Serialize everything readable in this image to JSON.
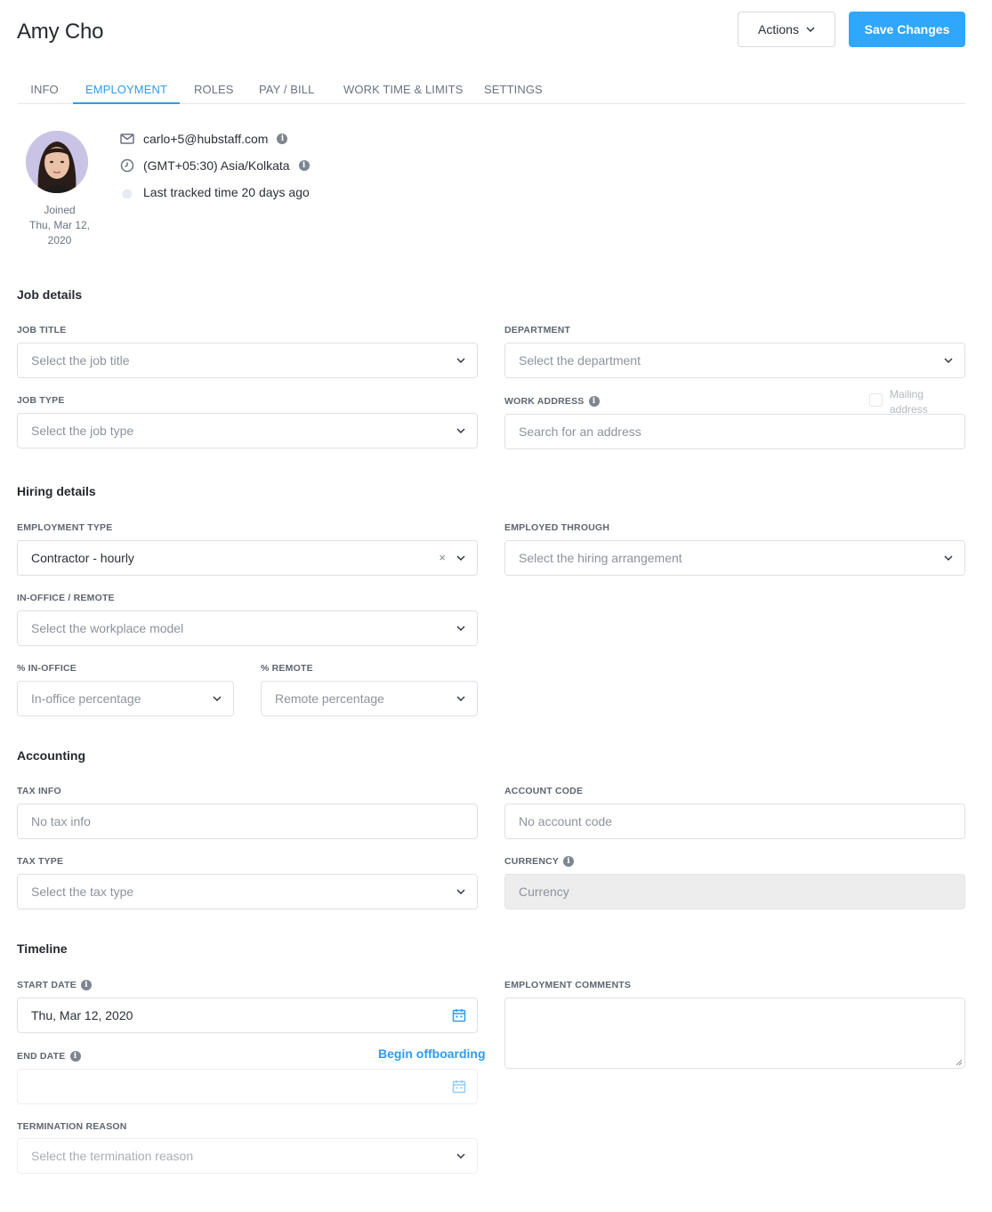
{
  "header": {
    "name": "Amy Cho",
    "actions_label": "Actions",
    "save_label": "Save Changes"
  },
  "tabs": [
    {
      "label": "INFO"
    },
    {
      "label": "EMPLOYMENT",
      "active": true
    },
    {
      "label": "ROLES"
    },
    {
      "label": "PAY / BILL"
    },
    {
      "label": "WORK TIME & LIMITS"
    },
    {
      "label": "SETTINGS"
    }
  ],
  "profile": {
    "joined_label": "Joined",
    "joined_date": "Thu, Mar 12, 2020",
    "email": "carlo+5@hubstaff.com",
    "timezone": "(GMT+05:30) Asia/Kolkata",
    "last_tracked": "Last tracked time 20 days ago"
  },
  "job_details": {
    "heading": "Job details",
    "job_title_label": "JOB TITLE",
    "job_title_placeholder": "Select the job title",
    "department_label": "DEPARTMENT",
    "department_placeholder": "Select the department",
    "job_type_label": "JOB TYPE",
    "job_type_placeholder": "Select the job type",
    "work_address_label": "WORK ADDRESS",
    "work_address_placeholder": "Search for an address",
    "mailing_address_label": "Mailing address"
  },
  "hiring_details": {
    "heading": "Hiring details",
    "employment_type_label": "EMPLOYMENT TYPE",
    "employment_type_value": "Contractor - hourly",
    "employed_through_label": "EMPLOYED THROUGH",
    "employed_through_placeholder": "Select the hiring arrangement",
    "workplace_label": "IN-OFFICE / REMOTE",
    "workplace_placeholder": "Select the workplace model",
    "in_office_label": "% IN-OFFICE",
    "in_office_placeholder": "In-office percentage",
    "remote_label": "% REMOTE",
    "remote_placeholder": "Remote percentage"
  },
  "accounting": {
    "heading": "Accounting",
    "tax_info_label": "TAX INFO",
    "tax_info_placeholder": "No tax info",
    "account_code_label": "ACCOUNT CODE",
    "account_code_placeholder": "No account code",
    "tax_type_label": "TAX TYPE",
    "tax_type_placeholder": "Select the tax type",
    "currency_label": "CURRENCY",
    "currency_placeholder": "Currency"
  },
  "timeline": {
    "heading": "Timeline",
    "start_date_label": "START DATE",
    "start_date_value": "Thu, Mar 12, 2020",
    "end_date_label": "END DATE",
    "begin_offboarding": "Begin offboarding",
    "termination_label": "TERMINATION REASON",
    "termination_placeholder": "Select the termination reason",
    "comments_label": "EMPLOYMENT COMMENTS"
  },
  "colors": {
    "accent": "#2f9bef",
    "save_button": "#2fa7ff"
  }
}
